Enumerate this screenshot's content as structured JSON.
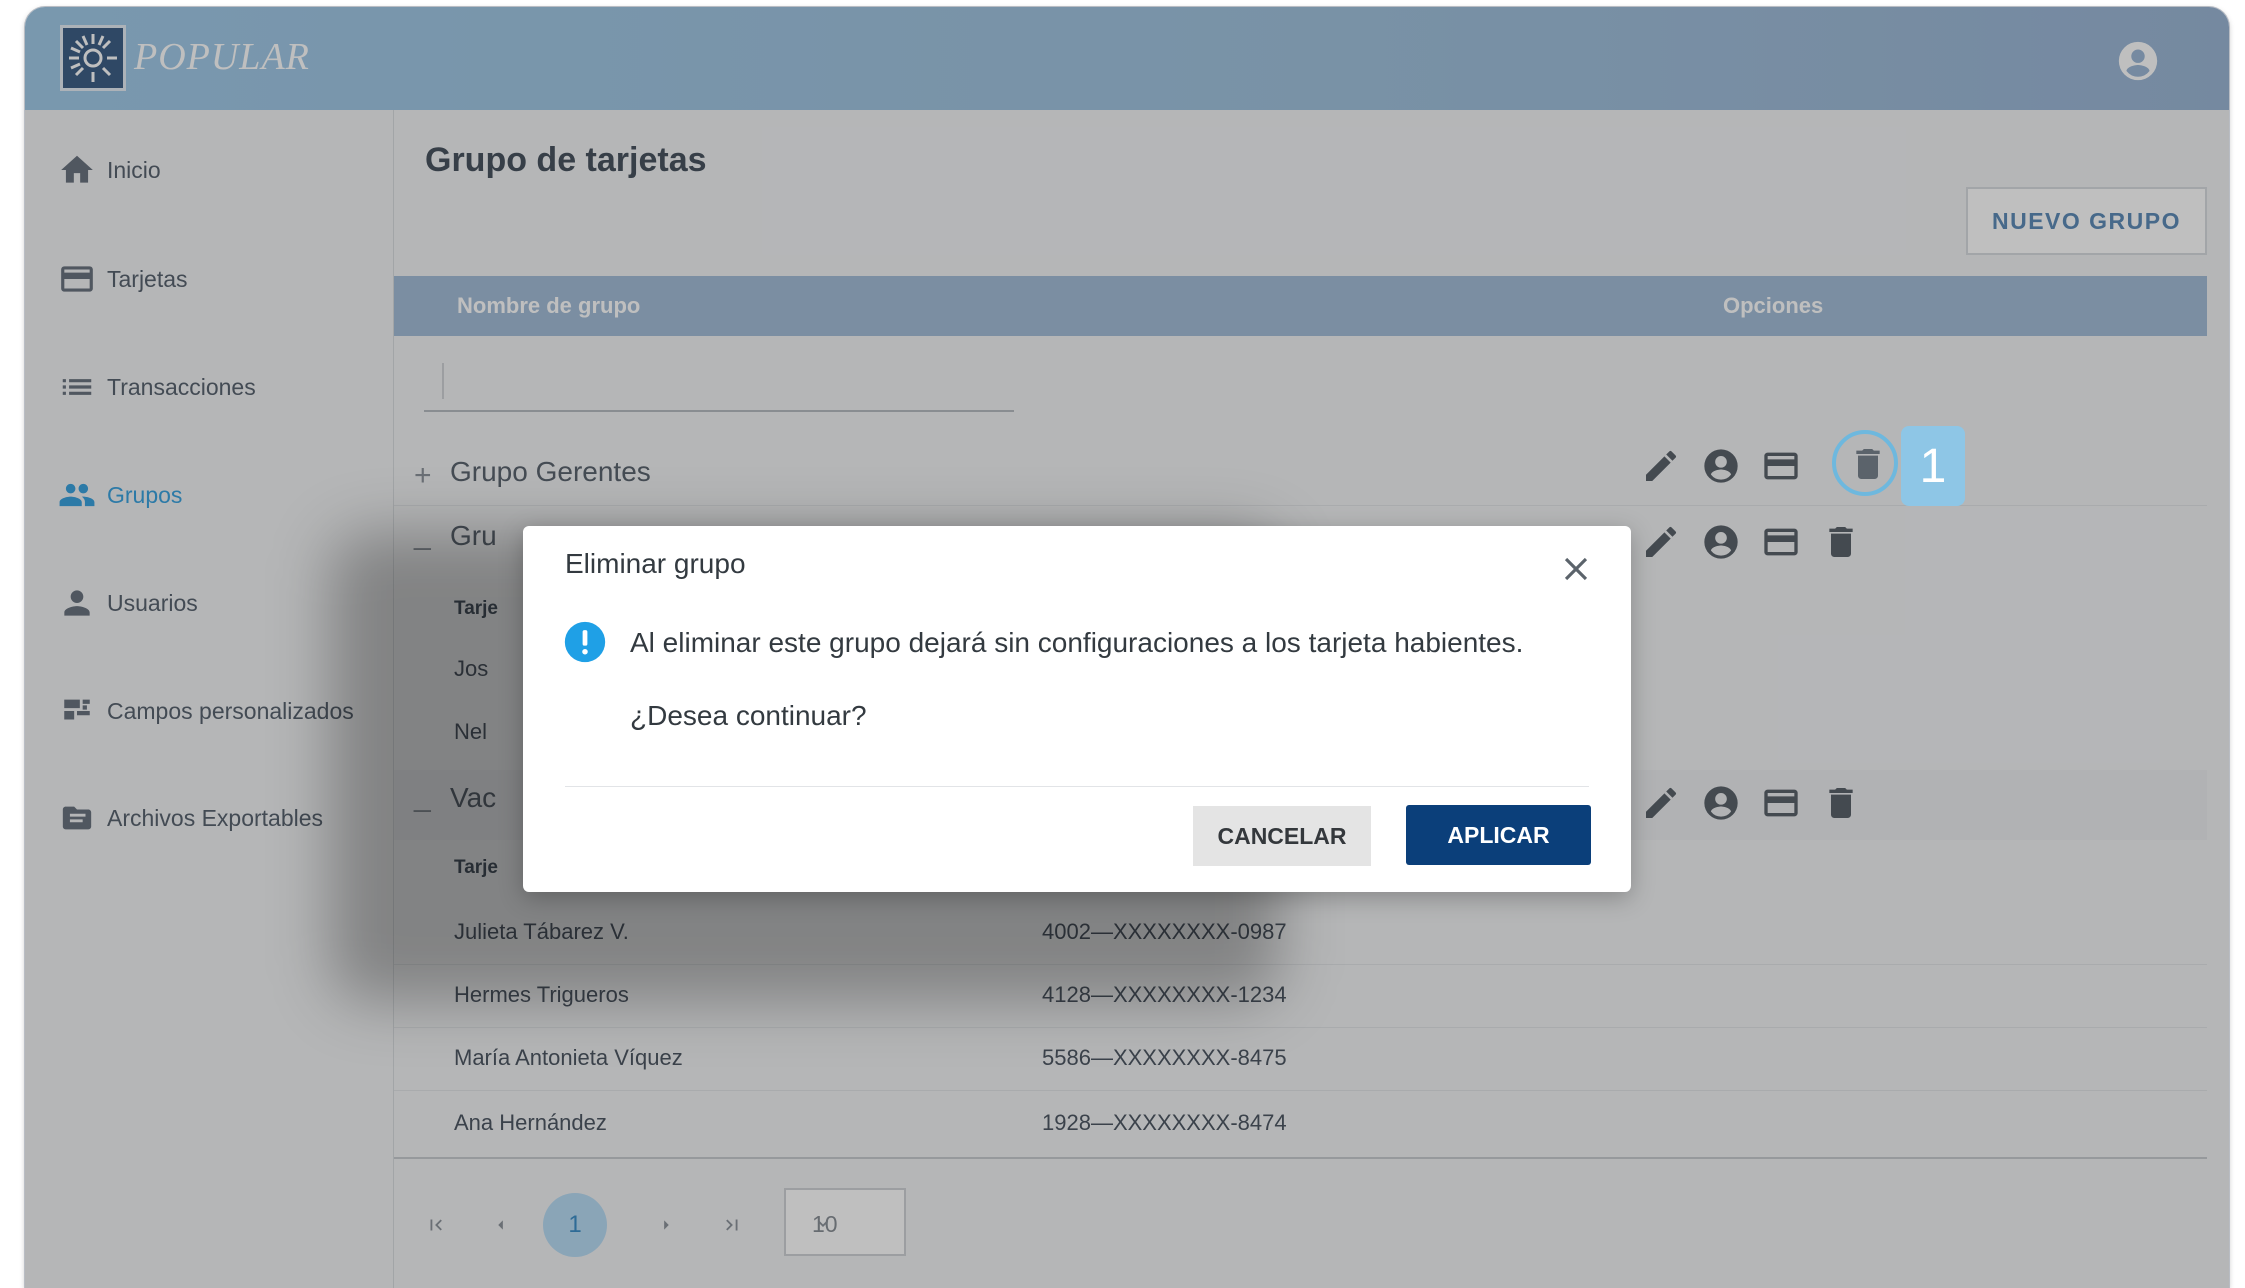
{
  "app": {
    "brand": "POPULAR"
  },
  "sidebar": {
    "items": [
      {
        "label": "Inicio",
        "icon": "home-icon"
      },
      {
        "label": "Tarjetas",
        "icon": "credit-card-icon"
      },
      {
        "label": "Transacciones",
        "icon": "list-icon"
      },
      {
        "label": "Grupos",
        "icon": "people-icon",
        "active": true
      },
      {
        "label": "Usuarios",
        "icon": "person-icon"
      },
      {
        "label": "Campos personalizados",
        "icon": "custom-fields-icon"
      },
      {
        "label": "Archivos Exportables",
        "icon": "folder-icon"
      }
    ]
  },
  "page": {
    "title": "Grupo de tarjetas",
    "new_group_label": "NUEVO GRUPO"
  },
  "table": {
    "headers": {
      "name": "Nombre de grupo",
      "options": "Opciones"
    },
    "groups": [
      {
        "expander": "+",
        "name": "Grupo Gerentes"
      },
      {
        "expander": "_",
        "name": "Gru"
      },
      {
        "expander": "_",
        "name": "Vac"
      }
    ],
    "sub_header": "Tarje",
    "partial_rows": [
      "Jos",
      "Nel"
    ],
    "rows": [
      {
        "name": "Julieta Tábarez V.",
        "card": "4002—XXXXXXXX-0987"
      },
      {
        "name": "Hermes Trigueros",
        "card": "4128—XXXXXXXX-1234"
      },
      {
        "name": "María Antonieta Víquez",
        "card": "5586—XXXXXXXX-8475"
      },
      {
        "name": "Ana Hernández",
        "card": "1928—XXXXXXXX-8474"
      }
    ]
  },
  "pagination": {
    "current_page": "1",
    "page_size": "10"
  },
  "modal": {
    "title": "Eliminar grupo",
    "message": "Al eliminar este grupo dejará sin configuraciones a los tarjeta habientes.",
    "question": "¿Desea continuar?",
    "cancel_label": "CANCELAR",
    "apply_label": "APLICAR"
  },
  "tutorial": {
    "step": "1"
  },
  "colors": {
    "header_bar": "#a2c3de",
    "accent": "#3ba3df",
    "table_header": "#a5bed8",
    "apply_button": "#0b3f7a",
    "info_icon": "#1fa0e6"
  }
}
